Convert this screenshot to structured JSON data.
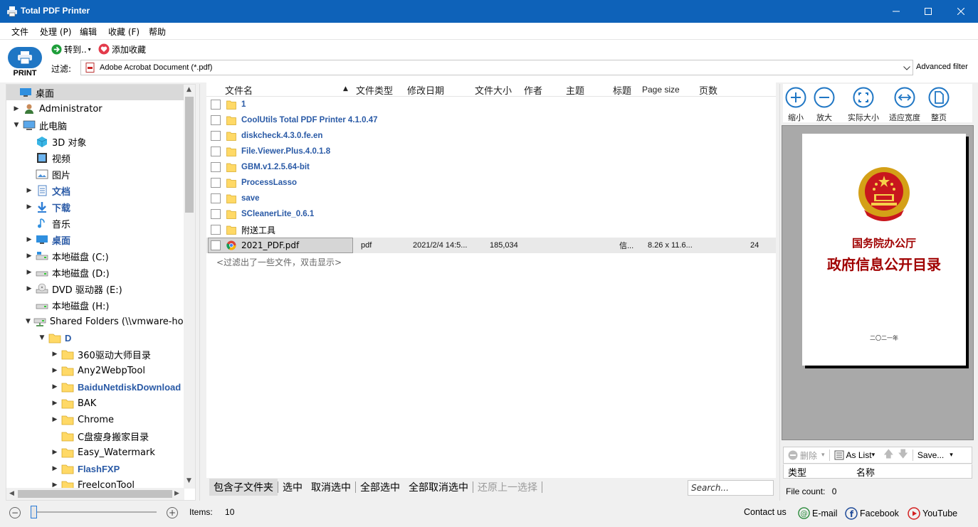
{
  "window": {
    "title": "Total PDF Printer"
  },
  "menu": [
    "文件",
    "处理 (P)",
    "编辑",
    "收藏 (F)",
    "帮助"
  ],
  "toolbar": {
    "print_label": "PRINT",
    "goto_label": "转到..",
    "add_fav_label": "添加收藏",
    "filter_label": "过滤:",
    "filter_value": "Adobe Acrobat Document (*.pdf)",
    "advanced_filter": "Advanced filter"
  },
  "tree": [
    {
      "label": "桌面",
      "indent": 0,
      "arrow": "",
      "icon": "desktop",
      "selected": true
    },
    {
      "label": "Administrator",
      "indent": 1,
      "arrow": "right",
      "icon": "user"
    },
    {
      "label": "此电脑",
      "indent": 1,
      "arrow": "down",
      "icon": "computer"
    },
    {
      "label": "3D 对象",
      "indent": 2,
      "arrow": "",
      "icon": "cube"
    },
    {
      "label": "视频",
      "indent": 2,
      "arrow": "",
      "icon": "video"
    },
    {
      "label": "图片",
      "indent": 2,
      "arrow": "",
      "icon": "picture"
    },
    {
      "label": "文档",
      "indent": 2,
      "arrow": "right",
      "icon": "document",
      "bold": true
    },
    {
      "label": "下载",
      "indent": 2,
      "arrow": "right",
      "icon": "download",
      "bold": true
    },
    {
      "label": "音乐",
      "indent": 2,
      "arrow": "",
      "icon": "music"
    },
    {
      "label": "桌面",
      "indent": 2,
      "arrow": "right",
      "icon": "desktop",
      "bold": true
    },
    {
      "label": "本地磁盘 (C:)",
      "indent": 2,
      "arrow": "right",
      "icon": "drive-c"
    },
    {
      "label": "本地磁盘 (D:)",
      "indent": 2,
      "arrow": "right",
      "icon": "drive"
    },
    {
      "label": "DVD 驱动器 (E:)",
      "indent": 2,
      "arrow": "right",
      "icon": "dvd"
    },
    {
      "label": "本地磁盘 (H:)",
      "indent": 2,
      "arrow": "",
      "icon": "drive"
    },
    {
      "label": "Shared Folders (\\\\vmware-host)",
      "indent": 2,
      "arrow": "down",
      "icon": "network-drive"
    },
    {
      "label": "D",
      "indent": 3,
      "arrow": "down",
      "icon": "folder",
      "bold": true
    },
    {
      "label": "360驱动大师目录",
      "indent": 4,
      "arrow": "right",
      "icon": "folder"
    },
    {
      "label": "Any2WebpTool",
      "indent": 4,
      "arrow": "right",
      "icon": "folder"
    },
    {
      "label": "BaiduNetdiskDownload",
      "indent": 4,
      "arrow": "right",
      "icon": "folder",
      "bold": true
    },
    {
      "label": "BAK",
      "indent": 4,
      "arrow": "right",
      "icon": "folder"
    },
    {
      "label": "Chrome",
      "indent": 4,
      "arrow": "right",
      "icon": "folder"
    },
    {
      "label": "C盘瘦身搬家目录",
      "indent": 4,
      "arrow": "",
      "icon": "folder"
    },
    {
      "label": "Easy_Watermark",
      "indent": 4,
      "arrow": "right",
      "icon": "folder"
    },
    {
      "label": "FlashFXP",
      "indent": 4,
      "arrow": "right",
      "icon": "folder",
      "bold": true
    },
    {
      "label": "FreeIconTool",
      "indent": 4,
      "arrow": "right",
      "icon": "folder"
    }
  ],
  "columns": [
    "文件名",
    "文件类型",
    "修改日期",
    "文件大小",
    "作者",
    "主题",
    "标题",
    "Page size",
    "页数"
  ],
  "files": [
    {
      "name": "1",
      "type": "folder",
      "bold": true
    },
    {
      "name": "CoolUtils Total PDF Printer 4.1.0.47",
      "type": "folder",
      "bold": true
    },
    {
      "name": "diskcheck.4.3.0.fe.en",
      "type": "folder",
      "bold": true
    },
    {
      "name": "File.Viewer.Plus.4.0.1.8",
      "type": "folder",
      "bold": true
    },
    {
      "name": "GBM.v1.2.5.64-bit",
      "type": "folder",
      "bold": true
    },
    {
      "name": "ProcessLasso",
      "type": "folder",
      "bold": true
    },
    {
      "name": "save",
      "type": "folder",
      "bold": true
    },
    {
      "name": "SCleanerLite_0.6.1",
      "type": "folder",
      "bold": true
    },
    {
      "name": "附送工具",
      "type": "folder",
      "bold": false
    },
    {
      "name": "2021_PDF.pdf",
      "type": "pdf",
      "bold": false,
      "selected": true,
      "filetype": "pdf",
      "modified": "2021/2/4 14:5...",
      "size": "185,034",
      "title": "信...",
      "page_size": "8.26 x 11.6...",
      "pages": "24"
    }
  ],
  "filtered_note": "<过滤出了一些文件，双击显示>",
  "selection_bar": {
    "include_subfolders": "包含子文件夹",
    "select": "选中",
    "deselect": "取消选中",
    "select_all": "全部选中",
    "deselect_all": "全部取消选中",
    "restore_selection": "还原上一选择"
  },
  "search_placeholder": "Search...",
  "preview_tools": [
    "缩小",
    "放大",
    "实际大小",
    "适应宽度",
    "整页"
  ],
  "preview_page": {
    "line1": "国务院办公厅",
    "line2": "政府信息公开目录",
    "line3": "二〇二一年"
  },
  "preview_bar": {
    "delete": "删除",
    "as_list": "As List",
    "save": "Save..."
  },
  "preview_list_headers": [
    "类型",
    "名称"
  ],
  "file_count_label": "File count:",
  "file_count_value": "0",
  "status": {
    "items_label": "Items:",
    "items_value": "10",
    "contact_us": "Contact us",
    "email": "E-mail",
    "facebook": "Facebook",
    "youtube": "YouTube"
  },
  "colors": {
    "titlebar": "#0e62b9",
    "folder": "#ffd966",
    "bold_link": "#2a5aa6",
    "preview_title": "#a00000"
  }
}
